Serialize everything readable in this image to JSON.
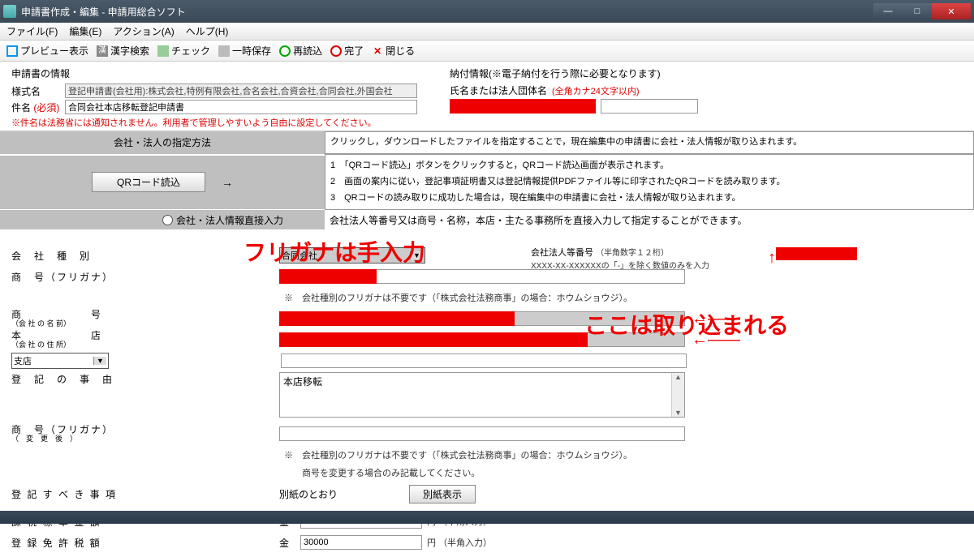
{
  "window": {
    "title": "申請書作成・編集 - 申請用総合ソフト"
  },
  "menu": {
    "file": "ファイル(F)",
    "edit": "編集(E)",
    "action": "アクション(A)",
    "help": "ヘルプ(H)"
  },
  "toolbar": {
    "preview": "プレビュー表示",
    "kanji": "漢字検索",
    "check": "チェック",
    "tempsave": "一時保存",
    "reload": "再読込",
    "done": "完了",
    "close": "閉じる"
  },
  "info": {
    "left_title": "申請書の情報",
    "style_label": "様式名",
    "style_value": "登記申請書(会社用):株式会社,特例有限会社,合名会社,合資会社,合同会社,外国会社",
    "kenmei_label": "件名",
    "kenmei_req": "(必須)",
    "kenmei_value": "合同会社本店移転登記申請書",
    "warn": "※件名は法務省には通知されません。利用者で管理しやすいよう自由に設定してください。",
    "right_title": "納付情報(※電子納付を行う際に必要となります)",
    "name_label": "氏名または法人団体名",
    "name_hint": "(全角カナ24文字以内)"
  },
  "gray_header": "会社・法人の指定方法",
  "instr_top": "クリックし，ダウンロードしたファイルを指定することで，現在編集中の申請書に会社・法人情報が取り込まれます。",
  "qr_btn": "QRコード読込",
  "qr_arrow": "→",
  "qr_steps": {
    "s1": "1　「QRコード読込」ボタンをクリックすると，QRコード読込画面が表示されます。",
    "s2": "2　画面の案内に従い，登記事項証明書又は登記情報提供PDFファイル等に印字されたQRコードを読み取ります。",
    "s3": "3　QRコードの読み取りに成功した場合は，現在編集中の申請書に会社・法人情報が取り込まれます。"
  },
  "radio_label": "会社・法人情報直接入力",
  "radio_desc": "会社法人等番号又は商号・名称，本店・主たる事務所を直接入力して指定することができます。",
  "annot1": "フリガナは手入力",
  "annot2": "ここは取り込まれる",
  "form": {
    "type_label": "会　社　種　別",
    "type_value": "合同会社",
    "corp_num_label": "会社法人等番号",
    "corp_num_hint": "（半角数字１２桁）",
    "corp_num_hint2": "XXXX-XX-XXXXXXの「-」を除く数値のみを入力",
    "furigana_label": "商　号（フリガナ）",
    "furigana_note": "※　会社種別のフリガナは不要です（「株式会社法務商事」の場合：ホウムショウジ）。",
    "shogo_label": "商　　　　　　号",
    "shogo_sub": "（会 社 の 名 前）",
    "honten_label": "本　　　　　　店",
    "honten_sub": "（会 社 の 住 所）",
    "shiten_select": "支店",
    "jiyuu_label": "登　記　の　事　由",
    "jiyuu_value": "本店移転",
    "furigana2_label": "商　号（フリガナ）",
    "furigana2_sub": "（　変　更　後　）",
    "furigana2_note1": "※　会社種別のフリガナは不要です（「株式会社法務商事」の場合：ホウムショウジ）。",
    "furigana2_note2": "　　商号を変更する場合のみ記載してください。",
    "subeki_label": "登 記 す べ き 事 項",
    "subeki_value": "別紙のとおり",
    "subeki_btn": "別紙表示",
    "kazei_label": "課 税 標 準 金 額",
    "kin": "金",
    "yen": "円",
    "hankaku": "（半角入力）",
    "menkyo_label": "登 録 免 許 税 額",
    "menkyo_value": "30000"
  }
}
